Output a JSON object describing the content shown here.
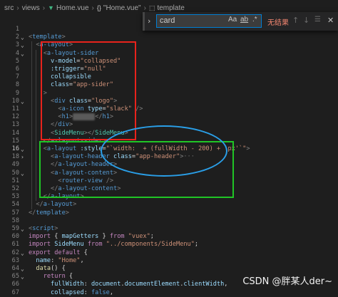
{
  "breadcrumb": {
    "items": [
      "src",
      "views",
      "Home.vue",
      "\"Home.vue\"",
      "template"
    ]
  },
  "find": {
    "query": "card",
    "match_case_label": "Aa",
    "whole_word_label": "ab",
    "regex_label": ".*",
    "no_results": "无结果"
  },
  "watermark": "CSDN @胖某人der~",
  "colors": {
    "annotation_red": "#e8231c",
    "annotation_green": "#20c526",
    "annotation_blue": "#2a9fe8"
  },
  "lines": [
    {
      "n": "1",
      "fold": "",
      "tokens": [
        [
          "",
          ""
        ]
      ]
    },
    {
      "n": "2",
      "fold": "⌄",
      "tokens": [
        [
          "t-br",
          "<"
        ],
        [
          "t-tag",
          "template"
        ],
        [
          "t-br",
          ">"
        ]
      ]
    },
    {
      "n": "3",
      "fold": "⌄",
      "tokens": [
        [
          "t-txt",
          "  "
        ],
        [
          "t-br",
          "<"
        ],
        [
          "t-tag",
          "a-layout"
        ],
        [
          "t-br",
          ">"
        ]
      ]
    },
    {
      "n": "4",
      "fold": "⌄",
      "tokens": [
        [
          "t-txt",
          "    "
        ],
        [
          "t-br",
          "<"
        ],
        [
          "t-tag",
          "a-layout-sider"
        ]
      ]
    },
    {
      "n": "5",
      "fold": "",
      "tokens": [
        [
          "t-txt",
          "      "
        ],
        [
          "t-attr",
          "v-model"
        ],
        [
          "t-txt",
          "="
        ],
        [
          "t-str",
          "\"collapsed\""
        ]
      ]
    },
    {
      "n": "6",
      "fold": "",
      "tokens": [
        [
          "t-txt",
          "      "
        ],
        [
          "t-attr",
          ":trigger"
        ],
        [
          "t-txt",
          "="
        ],
        [
          "t-str",
          "\"null\""
        ]
      ]
    },
    {
      "n": "7",
      "fold": "",
      "tokens": [
        [
          "t-txt",
          "      "
        ],
        [
          "t-attr",
          "collapsible"
        ]
      ]
    },
    {
      "n": "8",
      "fold": "",
      "tokens": [
        [
          "t-txt",
          "      "
        ],
        [
          "t-attr",
          "class"
        ],
        [
          "t-txt",
          "="
        ],
        [
          "t-str",
          "\"app-sider\""
        ]
      ]
    },
    {
      "n": "9",
      "fold": "",
      "tokens": [
        [
          "t-txt",
          "    "
        ],
        [
          "t-br",
          ">"
        ]
      ]
    },
    {
      "n": "10",
      "fold": "⌄",
      "tokens": [
        [
          "t-txt",
          "      "
        ],
        [
          "t-br",
          "<"
        ],
        [
          "t-tag",
          "div"
        ],
        [
          "t-txt",
          " "
        ],
        [
          "t-attr",
          "class"
        ],
        [
          "t-txt",
          "="
        ],
        [
          "t-str",
          "\"logo\""
        ],
        [
          "t-br",
          ">"
        ]
      ]
    },
    {
      "n": "11",
      "fold": "",
      "tokens": [
        [
          "t-txt",
          "        "
        ],
        [
          "t-br",
          "<"
        ],
        [
          "t-tag",
          "a-icon"
        ],
        [
          "t-txt",
          " "
        ],
        [
          "t-attr",
          "type"
        ],
        [
          "t-txt",
          "="
        ],
        [
          "t-str",
          "\"slack\""
        ],
        [
          "t-txt",
          " "
        ],
        [
          "t-br",
          "/>"
        ]
      ]
    },
    {
      "n": "12",
      "fold": "",
      "tokens": [
        [
          "t-txt",
          "        "
        ],
        [
          "t-br",
          "<"
        ],
        [
          "t-tag",
          "h1"
        ],
        [
          "t-br",
          ">"
        ],
        [
          "t-blur",
          "██████"
        ],
        [
          "t-br",
          "</"
        ],
        [
          "t-tag",
          "h1"
        ],
        [
          "t-br",
          ">"
        ]
      ]
    },
    {
      "n": "13",
      "fold": "",
      "tokens": [
        [
          "t-txt",
          "      "
        ],
        [
          "t-br",
          "</"
        ],
        [
          "t-tag",
          "div"
        ],
        [
          "t-br",
          ">"
        ]
      ]
    },
    {
      "n": "14",
      "fold": "",
      "tokens": [
        [
          "t-txt",
          "      "
        ],
        [
          "t-br",
          "<"
        ],
        [
          "t-ty",
          "SideMenu"
        ],
        [
          "t-br",
          "></"
        ],
        [
          "t-ty",
          "SideMenu"
        ],
        [
          "t-br",
          ">"
        ]
      ]
    },
    {
      "n": "15",
      "fold": "",
      "tokens": [
        [
          "t-txt",
          "    "
        ],
        [
          "t-br",
          "</"
        ],
        [
          "t-tag",
          "a-layout-sider"
        ],
        [
          "t-br",
          ">"
        ]
      ]
    },
    {
      "n": "16",
      "fold": "⌄",
      "tokens": [
        [
          "t-txt",
          "    "
        ],
        [
          "t-br",
          "<"
        ],
        [
          "t-tag",
          "a-layout"
        ],
        [
          "t-txt",
          " "
        ],
        [
          "t-attr",
          ":style"
        ],
        [
          "t-txt",
          "="
        ],
        [
          "t-str",
          "\"`width:  + (fullWidth - 200) + 'px'`\""
        ],
        [
          "t-br",
          ">"
        ]
      ]
    },
    {
      "n": "18",
      "fold": "›",
      "tokens": [
        [
          "t-txt",
          "      "
        ],
        [
          "t-br",
          "<"
        ],
        [
          "t-tag",
          "a-layout-header"
        ],
        [
          "t-txt",
          " "
        ],
        [
          "t-attr",
          "class"
        ],
        [
          "t-txt",
          "="
        ],
        [
          "t-str",
          "\"app-header\""
        ],
        [
          "t-br",
          ">"
        ],
        [
          "t-fold-ellipsis",
          "···"
        ]
      ]
    },
    {
      "n": "49",
      "fold": "",
      "tokens": [
        [
          "t-txt",
          "      "
        ],
        [
          "t-br",
          "</"
        ],
        [
          "t-tag",
          "a-layout-header"
        ],
        [
          "t-br",
          ">"
        ]
      ]
    },
    {
      "n": "50",
      "fold": "⌄",
      "tokens": [
        [
          "t-txt",
          "      "
        ],
        [
          "t-br",
          "<"
        ],
        [
          "t-tag",
          "a-layout-content"
        ],
        [
          "t-br",
          ">"
        ]
      ]
    },
    {
      "n": "51",
      "fold": "",
      "tokens": [
        [
          "t-txt",
          "        "
        ],
        [
          "t-br",
          "<"
        ],
        [
          "t-tag",
          "router-view"
        ],
        [
          "t-txt",
          " "
        ],
        [
          "t-br",
          "/>"
        ]
      ]
    },
    {
      "n": "52",
      "fold": "",
      "tokens": [
        [
          "t-txt",
          "      "
        ],
        [
          "t-br",
          "</"
        ],
        [
          "t-tag",
          "a-layout-content"
        ],
        [
          "t-br",
          ">"
        ]
      ]
    },
    {
      "n": "53",
      "fold": "",
      "tokens": [
        [
          "t-txt",
          "    "
        ],
        [
          "t-br",
          "</"
        ],
        [
          "t-tag",
          "a-layout"
        ],
        [
          "t-br",
          ">"
        ]
      ]
    },
    {
      "n": "54",
      "fold": "",
      "tokens": [
        [
          "t-txt",
          "  "
        ],
        [
          "t-br",
          "</"
        ],
        [
          "t-tag",
          "a-layout"
        ],
        [
          "t-br",
          ">"
        ]
      ]
    },
    {
      "n": "57",
      "fold": "",
      "tokens": [
        [
          "t-br",
          "</"
        ],
        [
          "t-tag",
          "template"
        ],
        [
          "t-br",
          ">"
        ]
      ]
    },
    {
      "n": "58",
      "fold": "",
      "tokens": [
        [
          "",
          ""
        ]
      ]
    },
    {
      "n": "59",
      "fold": "⌄",
      "tokens": [
        [
          "t-br",
          "<"
        ],
        [
          "t-tag",
          "script"
        ],
        [
          "t-br",
          ">"
        ]
      ]
    },
    {
      "n": "60",
      "fold": "",
      "tokens": [
        [
          "t-kw",
          "import"
        ],
        [
          "t-txt",
          " { "
        ],
        [
          "t-var",
          "mapGetters"
        ],
        [
          "t-txt",
          " } "
        ],
        [
          "t-kw",
          "from"
        ],
        [
          "t-txt",
          " "
        ],
        [
          "t-str",
          "\"vuex\""
        ],
        [
          "t-txt",
          ";"
        ]
      ]
    },
    {
      "n": "61",
      "fold": "",
      "tokens": [
        [
          "t-kw",
          "import"
        ],
        [
          "t-txt",
          " "
        ],
        [
          "t-var",
          "SideMenu"
        ],
        [
          "t-txt",
          " "
        ],
        [
          "t-kw",
          "from"
        ],
        [
          "t-txt",
          " "
        ],
        [
          "t-str",
          "\"../components/SideMenu\""
        ],
        [
          "t-txt",
          ";"
        ]
      ]
    },
    {
      "n": "62",
      "fold": "⌄",
      "tokens": [
        [
          "t-kw",
          "export"
        ],
        [
          "t-txt",
          " "
        ],
        [
          "t-kw",
          "default"
        ],
        [
          "t-txt",
          " {"
        ]
      ]
    },
    {
      "n": "63",
      "fold": "",
      "tokens": [
        [
          "t-txt",
          "  "
        ],
        [
          "t-var",
          "name"
        ],
        [
          "t-txt",
          ": "
        ],
        [
          "t-str",
          "\"Home\""
        ],
        [
          "t-txt",
          ","
        ]
      ]
    },
    {
      "n": "64",
      "fold": "⌄",
      "tokens": [
        [
          "t-txt",
          "  "
        ],
        [
          "t-fn",
          "data"
        ],
        [
          "t-txt",
          "() {"
        ]
      ]
    },
    {
      "n": "65",
      "fold": "⌄",
      "tokens": [
        [
          "t-txt",
          "    "
        ],
        [
          "t-kw",
          "return"
        ],
        [
          "t-txt",
          " {"
        ]
      ]
    },
    {
      "n": "66",
      "fold": "",
      "tokens": [
        [
          "t-txt",
          "      "
        ],
        [
          "t-var",
          "fullWidth"
        ],
        [
          "t-txt",
          ": "
        ],
        [
          "t-var",
          "document"
        ],
        [
          "t-txt",
          "."
        ],
        [
          "t-var",
          "documentElement"
        ],
        [
          "t-txt",
          "."
        ],
        [
          "t-var",
          "clientWidth"
        ],
        [
          "t-txt",
          ","
        ]
      ]
    },
    {
      "n": "67",
      "fold": "",
      "tokens": [
        [
          "t-txt",
          "      "
        ],
        [
          "t-var",
          "collapsed"
        ],
        [
          "t-txt",
          ": "
        ],
        [
          "t-kw2",
          "false"
        ],
        [
          "t-txt",
          ","
        ]
      ]
    }
  ]
}
